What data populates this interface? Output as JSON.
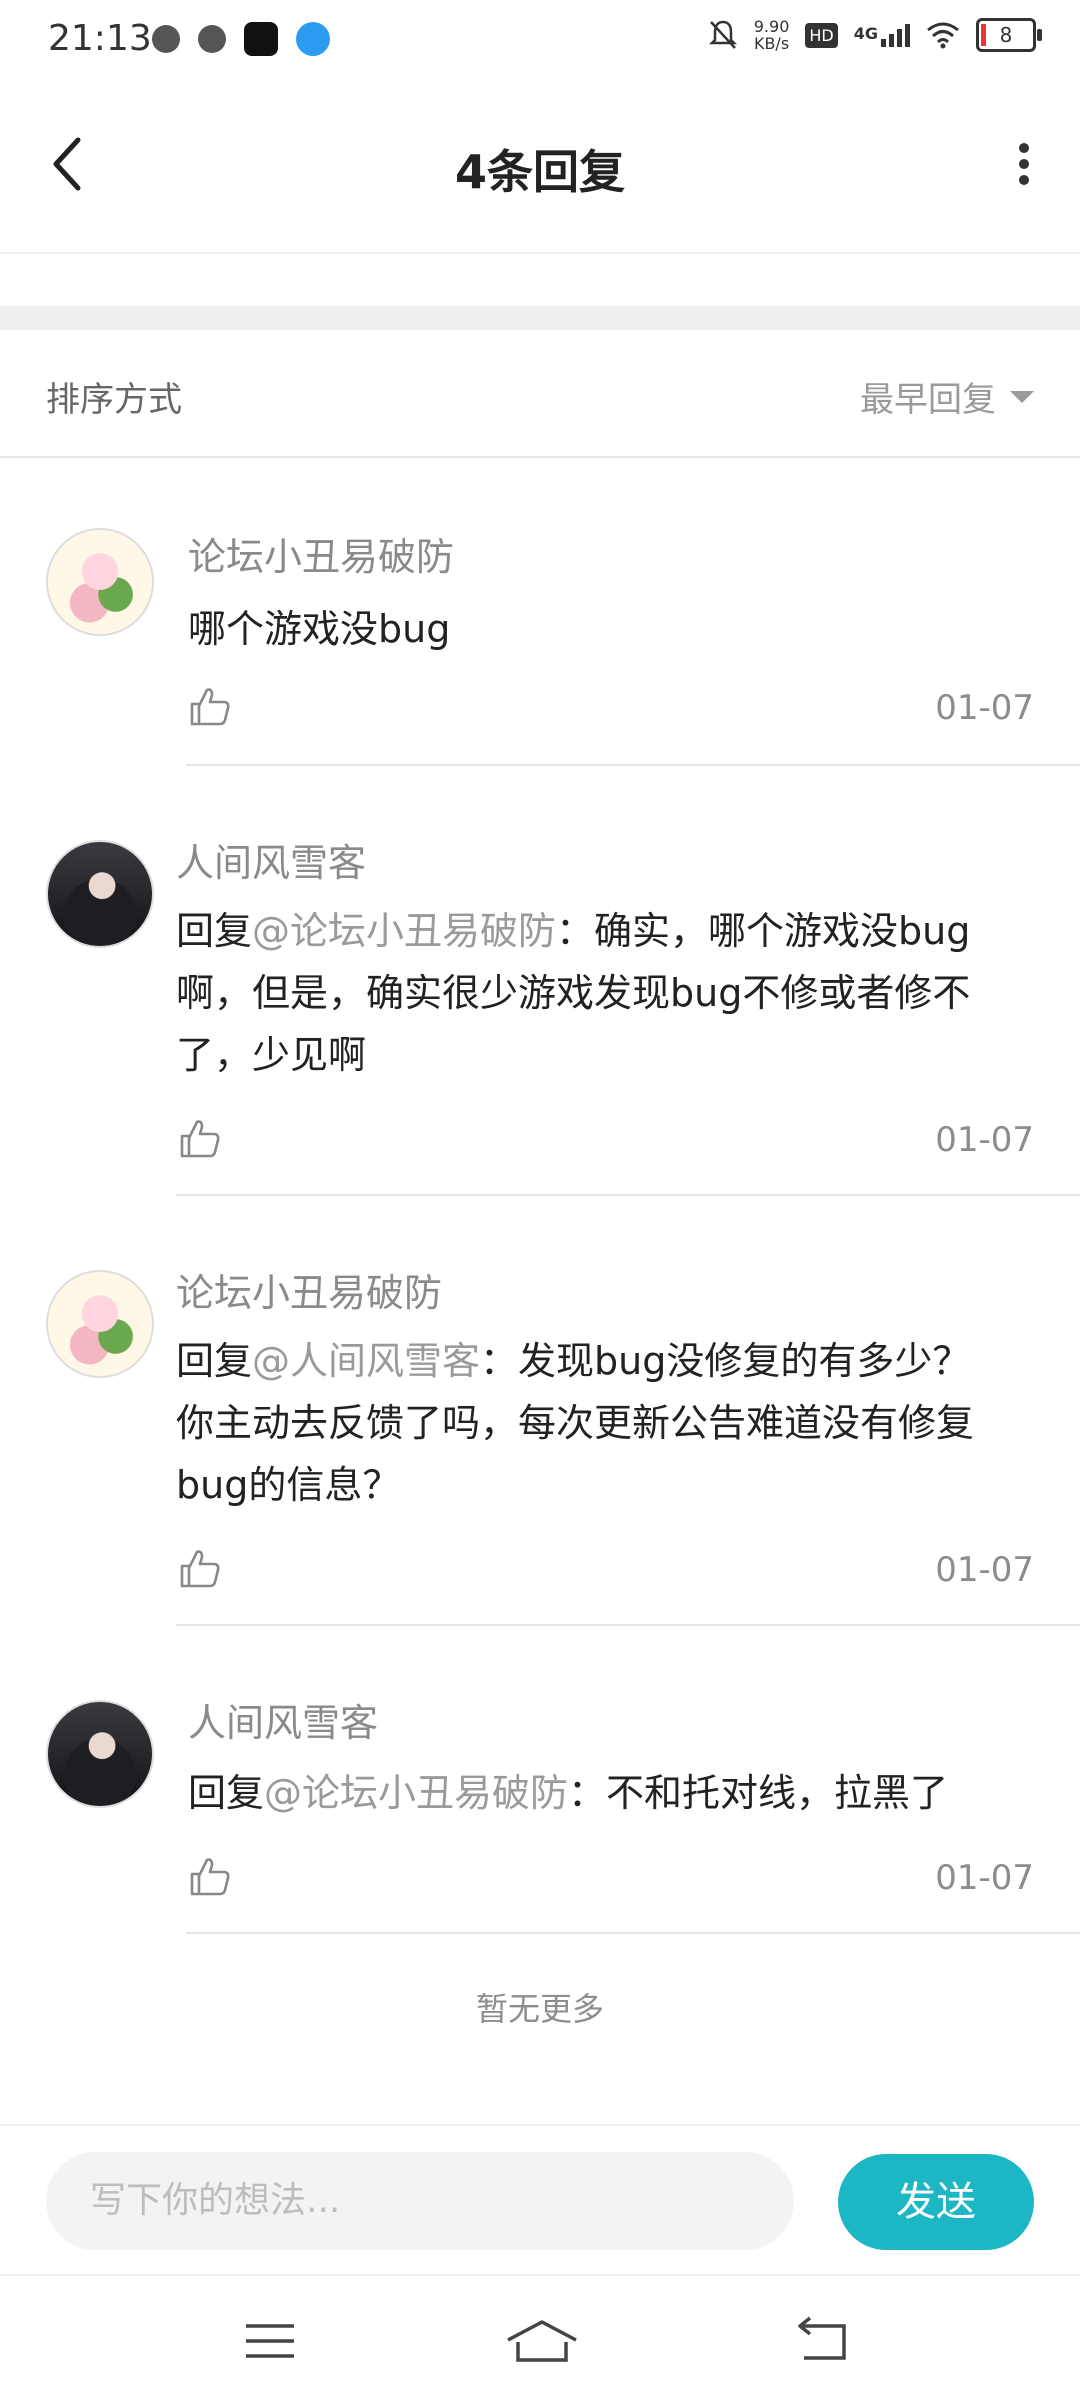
{
  "status_bar": {
    "time": "21:13",
    "net_speed_top": "9.90",
    "net_speed_bottom": "KB/s",
    "hd": "HD",
    "network": "4G",
    "battery": "8"
  },
  "header": {
    "title": "4条回复"
  },
  "sort": {
    "label": "排序方式",
    "value": "最早回复"
  },
  "comments": [
    {
      "username": "论坛小丑易破防",
      "prefix": "",
      "mention": "",
      "text": "哪个游戏没bug",
      "date": "01-07",
      "avatar": "fox-girl"
    },
    {
      "username": "人间风雪客",
      "prefix": "回复",
      "mention": "@论坛小丑易破防",
      "text": "：确实，哪个游戏没bug啊，但是，确实很少游戏发现bug不修或者修不了，少见啊",
      "date": "01-07",
      "avatar": "dark-girl"
    },
    {
      "username": "论坛小丑易破防",
      "prefix": "回复",
      "mention": "@人间风雪客",
      "text": "：发现bug没修复的有多少？你主动去反馈了吗，每次更新公告难道没有修复bug的信息？",
      "date": "01-07",
      "avatar": "fox-girl"
    },
    {
      "username": "人间风雪客",
      "prefix": "回复",
      "mention": "@论坛小丑易破防",
      "text": "：不和托对线，拉黑了",
      "date": "01-07",
      "avatar": "dark-girl"
    }
  ],
  "footer_note": "暂无更多",
  "input": {
    "placeholder": "写下你的想法...",
    "send_label": "发送"
  },
  "colors": {
    "accent": "#1cb6c5",
    "mention": "#9a9a9a"
  }
}
